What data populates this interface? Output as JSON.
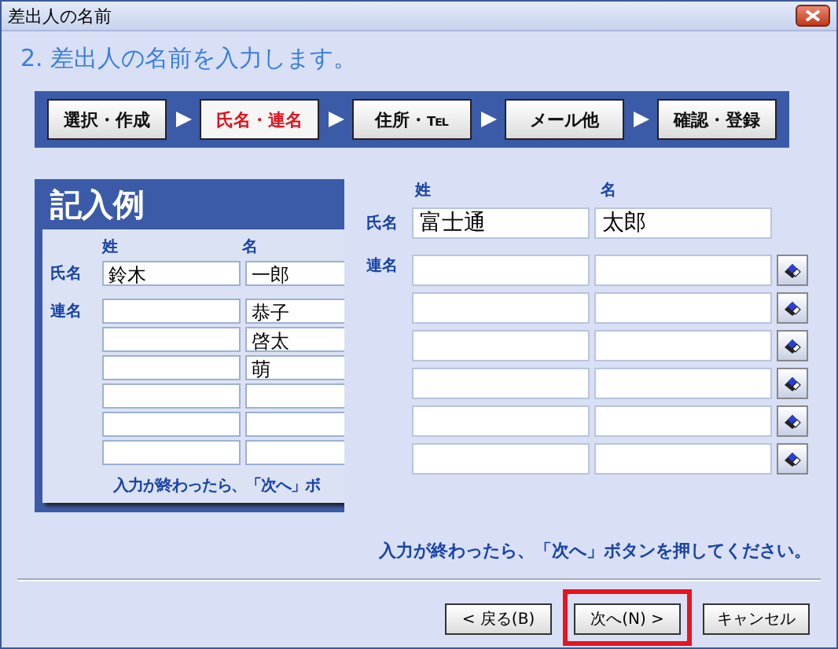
{
  "window": {
    "title": "差出人の名前"
  },
  "heading": "2. 差出人の名前を入力します。",
  "steps": [
    {
      "label": "選択・作成",
      "selected": false
    },
    {
      "label": "氏名・連名",
      "selected": true
    },
    {
      "label": "住所・℡",
      "selected": false
    },
    {
      "label": "メール他",
      "selected": false
    },
    {
      "label": "確認・登録",
      "selected": false
    }
  ],
  "example": {
    "title": "記入例",
    "column_labels": [
      "姓",
      "名"
    ],
    "name_label": "氏名",
    "family_name": "鈴木",
    "given_name": "一郎",
    "joint_label": "連名",
    "joint_rows": [
      {
        "given": "恭子"
      },
      {
        "given": "啓太"
      },
      {
        "given": "萌"
      },
      {},
      {},
      {}
    ],
    "note": "入力が終わったら、「次へ」ボ"
  },
  "form": {
    "column_labels": [
      "姓",
      "名"
    ],
    "name_label": "氏名",
    "family_name": "富士通",
    "given_name": "太郎",
    "joint_label": "連名",
    "joint_rows": [
      {},
      {},
      {},
      {},
      {},
      {}
    ]
  },
  "instruction": "入力が終わったら、「次へ」ボタンを押してください。",
  "buttons": [
    {
      "label": "< 戻る(B)",
      "highlighted": false
    },
    {
      "label": "次へ(N) >",
      "highlighted": true
    },
    {
      "label": "キャンセル",
      "highlighted": false
    }
  ]
}
